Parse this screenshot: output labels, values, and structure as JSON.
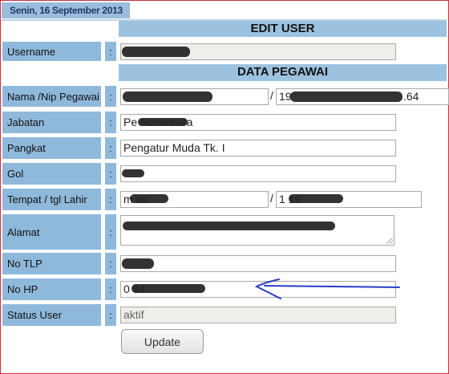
{
  "date_bar": "Senin, 16 September 2013",
  "sections": {
    "edit_user": "EDIT USER",
    "data_pegawai": "DATA PEGAWAI"
  },
  "separator": ":",
  "fields": {
    "username": {
      "label": "Username",
      "value": ""
    },
    "nama_nip": {
      "label": "Nama /Nip Pegawai",
      "nama_value": "",
      "nip_value": "19",
      "nip_tail": ".64"
    },
    "jabatan": {
      "label": "Jabatan",
      "value": "Pe          Administra"
    },
    "pangkat": {
      "label": "Pangkat",
      "value": "Pengatur Muda Tk. I"
    },
    "gol": {
      "label": "Gol",
      "value": ""
    },
    "tempat_tgl": {
      "label": "Tempat / tgl Lahir",
      "tempat_value": "m         do",
      "tgl_value": "1           19"
    },
    "alamat": {
      "label": "Alamat",
      "value": ""
    },
    "no_tlp": {
      "label": "No TLP",
      "value": ""
    },
    "no_hp": {
      "label": "No HP",
      "value": "0            84"
    },
    "status_user": {
      "label": "Status User",
      "value": "aktif"
    }
  },
  "nip_separator": "/",
  "tgl_separator": "/",
  "update_button": "Update",
  "colors": {
    "section": "#9cc2e0",
    "label": "#8fb9db",
    "datebar": "#9bbcdb",
    "arrow": "#2a3cc9"
  }
}
